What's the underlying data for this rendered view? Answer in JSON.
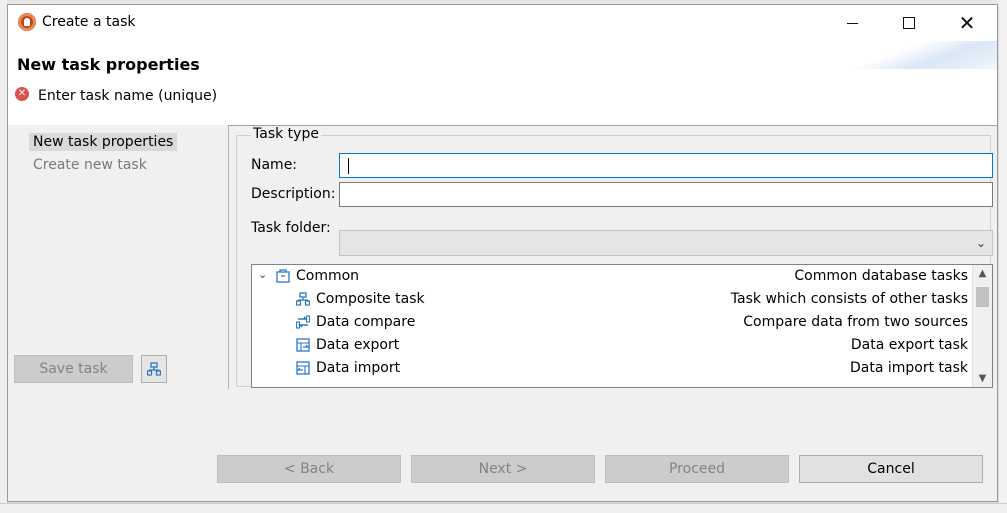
{
  "window": {
    "title": "Create a task"
  },
  "header": {
    "title": "New task properties",
    "message": "Enter task name (unique)"
  },
  "nav": {
    "items": [
      {
        "label": "New task properties",
        "active": true
      },
      {
        "label": "Create new task",
        "active": false
      }
    ],
    "save_task_label": "Save task"
  },
  "form": {
    "group_label": "Task type",
    "name_label": "Name:",
    "name_value": "",
    "description_label": "Description:",
    "description_value": "",
    "folder_label": "Task folder:",
    "folder_value": ""
  },
  "tree": {
    "category": {
      "name": "Common",
      "description": "Common database tasks",
      "icon": "folder-icon"
    },
    "items": [
      {
        "name": "Composite task",
        "description": "Task which consists of other tasks",
        "icon": "composite-task-icon"
      },
      {
        "name": "Data compare",
        "description": "Compare data from two sources",
        "icon": "data-compare-icon"
      },
      {
        "name": "Data export",
        "description": "Data export task",
        "icon": "data-export-icon"
      },
      {
        "name": "Data import",
        "description": "Data import task",
        "icon": "data-import-icon"
      }
    ]
  },
  "buttons": {
    "back": "< Back",
    "next": "Next >",
    "proceed": "Proceed",
    "cancel": "Cancel"
  },
  "colors": {
    "accent": "#0078d7",
    "icon_blue": "#2b79c2",
    "error": "#d9534f"
  }
}
